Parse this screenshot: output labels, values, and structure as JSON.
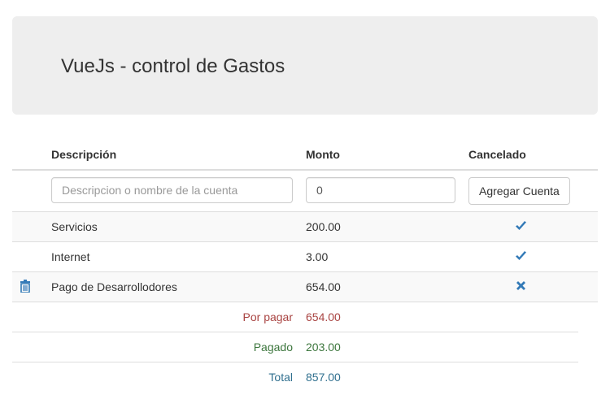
{
  "app": {
    "title": "VueJs - control de Gastos"
  },
  "table": {
    "headers": {
      "description": "Descripción",
      "amount": "Monto",
      "paid": "Cancelado"
    },
    "form": {
      "description_placeholder": "Descripcion o nombre de la cuenta",
      "amount_value": "0",
      "add_button": "Agregar Cuenta"
    },
    "rows": [
      {
        "description": "Servicios",
        "amount": "200.00",
        "status": "check-icon"
      },
      {
        "description": "Internet",
        "amount": "3.00",
        "status": "check-icon"
      },
      {
        "description": "Pago de Desarrollodores",
        "amount": "654.00",
        "status": "remove-icon"
      }
    ]
  },
  "summary": {
    "pending_label": "Por pagar",
    "pending_value": "654.00",
    "paid_label": "Pagado",
    "paid_value": "203.00",
    "total_label": "Total",
    "total_value": "857.00"
  },
  "colors": {
    "accent": "#337ab7",
    "pending": "#a94442",
    "paid": "#3c763d",
    "total": "#31708f"
  }
}
